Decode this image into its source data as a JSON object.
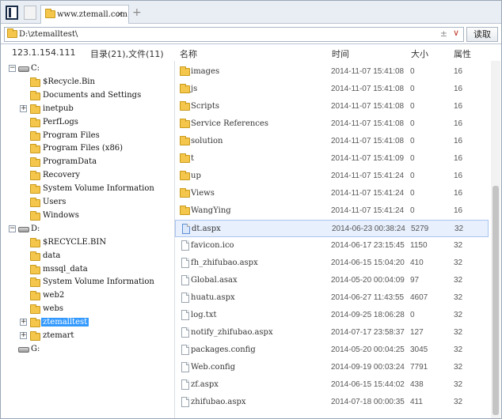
{
  "tabs": {
    "active_label": "www.ztemall.com",
    "close": "×",
    "add": "+"
  },
  "address": {
    "path": "D:\\ztemalltest\\",
    "pm": "±",
    "dropdown": "∨",
    "read_button": "读取"
  },
  "header": {
    "ip": "123.1.154.111",
    "dir_count": "目录(21),文件(11)",
    "col_name": "名称",
    "col_time": "时间",
    "col_size": "大小",
    "col_attr": "属性"
  },
  "tree": [
    {
      "label": "C:",
      "type": "drive",
      "expander": "−"
    },
    {
      "label": "$Recycle.Bin",
      "type": "folder"
    },
    {
      "label": "Documents and Settings",
      "type": "folder"
    },
    {
      "label": "inetpub",
      "type": "folder",
      "expander": "+"
    },
    {
      "label": "PerfLogs",
      "type": "folder"
    },
    {
      "label": "Program Files",
      "type": "folder"
    },
    {
      "label": "Program Files (x86)",
      "type": "folder"
    },
    {
      "label": "ProgramData",
      "type": "folder"
    },
    {
      "label": "Recovery",
      "type": "folder"
    },
    {
      "label": "System Volume Information",
      "type": "folder"
    },
    {
      "label": "Users",
      "type": "folder"
    },
    {
      "label": "Windows",
      "type": "folder"
    },
    {
      "label": "D:",
      "type": "drive",
      "expander": "−"
    },
    {
      "label": "$RECYCLE.BIN",
      "type": "folder"
    },
    {
      "label": "data",
      "type": "folder"
    },
    {
      "label": "mssql_data",
      "type": "folder"
    },
    {
      "label": "System Volume Information",
      "type": "folder"
    },
    {
      "label": "web2",
      "type": "folder"
    },
    {
      "label": "webs",
      "type": "folder"
    },
    {
      "label": "ztemalltest",
      "type": "folder",
      "expander": "+",
      "selected": true
    },
    {
      "label": "ztemart",
      "type": "folder",
      "expander": "+"
    },
    {
      "label": "G:",
      "type": "drive"
    }
  ],
  "files": [
    {
      "name": "images",
      "type": "folder",
      "time": "2014-11-07 15:41:08",
      "size": "0",
      "attr": "16"
    },
    {
      "name": "js",
      "type": "folder",
      "time": "2014-11-07 15:41:08",
      "size": "0",
      "attr": "16"
    },
    {
      "name": "Scripts",
      "type": "folder",
      "time": "2014-11-07 15:41:08",
      "size": "0",
      "attr": "16"
    },
    {
      "name": "Service References",
      "type": "folder",
      "time": "2014-11-07 15:41:08",
      "size": "0",
      "attr": "16"
    },
    {
      "name": "solution",
      "type": "folder",
      "time": "2014-11-07 15:41:08",
      "size": "0",
      "attr": "16"
    },
    {
      "name": "t",
      "type": "folder",
      "time": "2014-11-07 15:41:09",
      "size": "0",
      "attr": "16"
    },
    {
      "name": "up",
      "type": "folder",
      "time": "2014-11-07 15:41:24",
      "size": "0",
      "attr": "16"
    },
    {
      "name": "Views",
      "type": "folder",
      "time": "2014-11-07 15:41:24",
      "size": "0",
      "attr": "16"
    },
    {
      "name": "WangYing",
      "type": "folder",
      "time": "2014-11-07 15:41:24",
      "size": "0",
      "attr": "16"
    },
    {
      "name": "dt.aspx",
      "type": "file",
      "time": "2014-06-23 00:38:24",
      "size": "5279",
      "attr": "32",
      "selected": true
    },
    {
      "name": "favicon.ico",
      "type": "file",
      "time": "2014-06-17 23:15:45",
      "size": "1150",
      "attr": "32"
    },
    {
      "name": "fh_zhifubao.aspx",
      "type": "file",
      "time": "2014-06-15 15:04:20",
      "size": "410",
      "attr": "32"
    },
    {
      "name": "Global.asax",
      "type": "file",
      "time": "2014-05-20 00:04:09",
      "size": "97",
      "attr": "32"
    },
    {
      "name": "huatu.aspx",
      "type": "file",
      "time": "2014-06-27 11:43:55",
      "size": "4607",
      "attr": "32"
    },
    {
      "name": "log.txt",
      "type": "file",
      "time": "2014-09-25 18:06:28",
      "size": "0",
      "attr": "32"
    },
    {
      "name": "notify_zhifubao.aspx",
      "type": "file",
      "time": "2014-07-17 23:58:37",
      "size": "127",
      "attr": "32"
    },
    {
      "name": "packages.config",
      "type": "file",
      "time": "2014-05-20 00:04:25",
      "size": "3045",
      "attr": "32"
    },
    {
      "name": "Web.config",
      "type": "file",
      "time": "2014-09-19 00:03:24",
      "size": "7791",
      "attr": "32"
    },
    {
      "name": "zf.aspx",
      "type": "file",
      "time": "2014-06-15 15:44:02",
      "size": "438",
      "attr": "32"
    },
    {
      "name": "zhifubao.aspx",
      "type": "file",
      "time": "2014-07-18 00:00:35",
      "size": "411",
      "attr": "32"
    }
  ]
}
